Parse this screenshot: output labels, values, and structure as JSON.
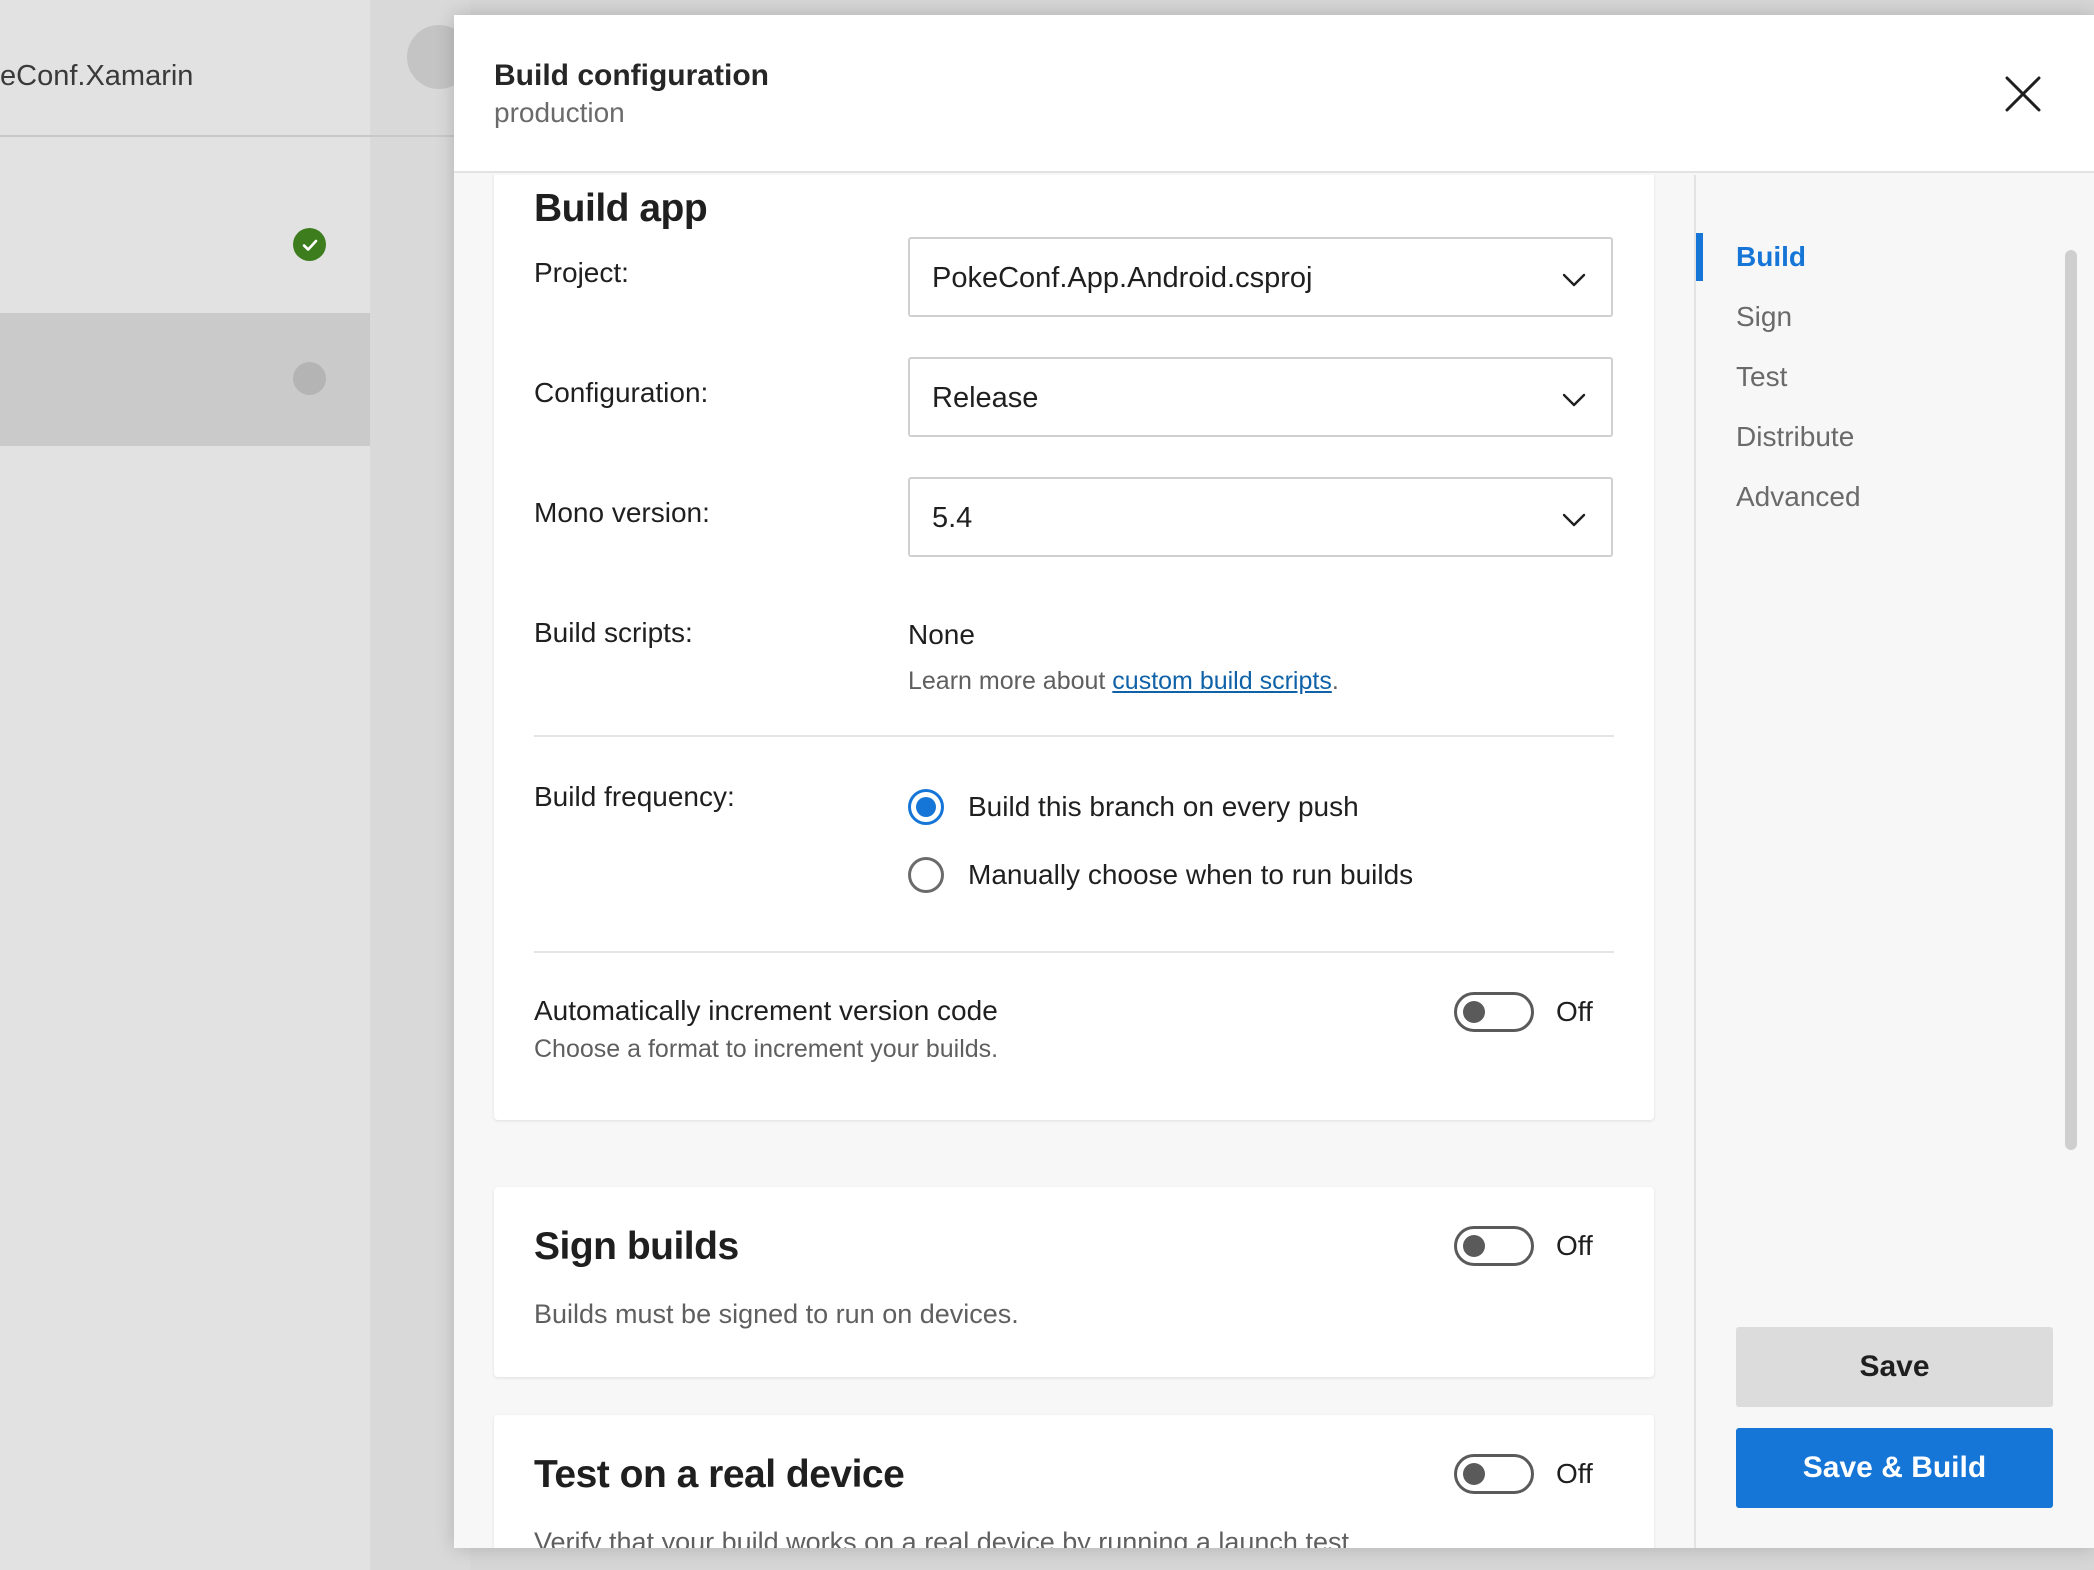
{
  "background": {
    "app_name": "eConf.Xamarin"
  },
  "modal": {
    "title": "Build configuration",
    "subtitle": "production"
  },
  "build_app": {
    "title": "Build app",
    "project": {
      "label": "Project:",
      "value": "PokeConf.App.Android.csproj"
    },
    "configuration": {
      "label": "Configuration:",
      "value": "Release"
    },
    "mono": {
      "label": "Mono version:",
      "value": "5.4"
    },
    "scripts": {
      "label": "Build scripts:",
      "value": "None",
      "help_prefix": "Learn more about ",
      "help_link": "custom build scripts",
      "help_suffix": "."
    },
    "frequency": {
      "label": "Build frequency:",
      "options": [
        {
          "label": "Build this branch on every push",
          "checked": true
        },
        {
          "label": "Manually choose when to run builds",
          "checked": false
        }
      ]
    },
    "auto_increment": {
      "title": "Automatically increment version code",
      "subtitle": "Choose a format to increment your builds.",
      "toggle_label": "Off"
    }
  },
  "sign": {
    "title": "Sign builds",
    "subtitle": "Builds must be signed to run on devices.",
    "toggle_label": "Off"
  },
  "test": {
    "title": "Test on a real device",
    "subtitle": "Verify that your build works on a real device by running a launch test.",
    "toggle_label": "Off"
  },
  "nav": {
    "items": [
      "Build",
      "Sign",
      "Test",
      "Distribute",
      "Advanced"
    ],
    "active": "Build"
  },
  "buttons": {
    "save": "Save",
    "save_build": "Save & Build"
  },
  "colors": {
    "accent": "#1576d8",
    "success": "#3e7d1e",
    "link": "#1062a8"
  }
}
